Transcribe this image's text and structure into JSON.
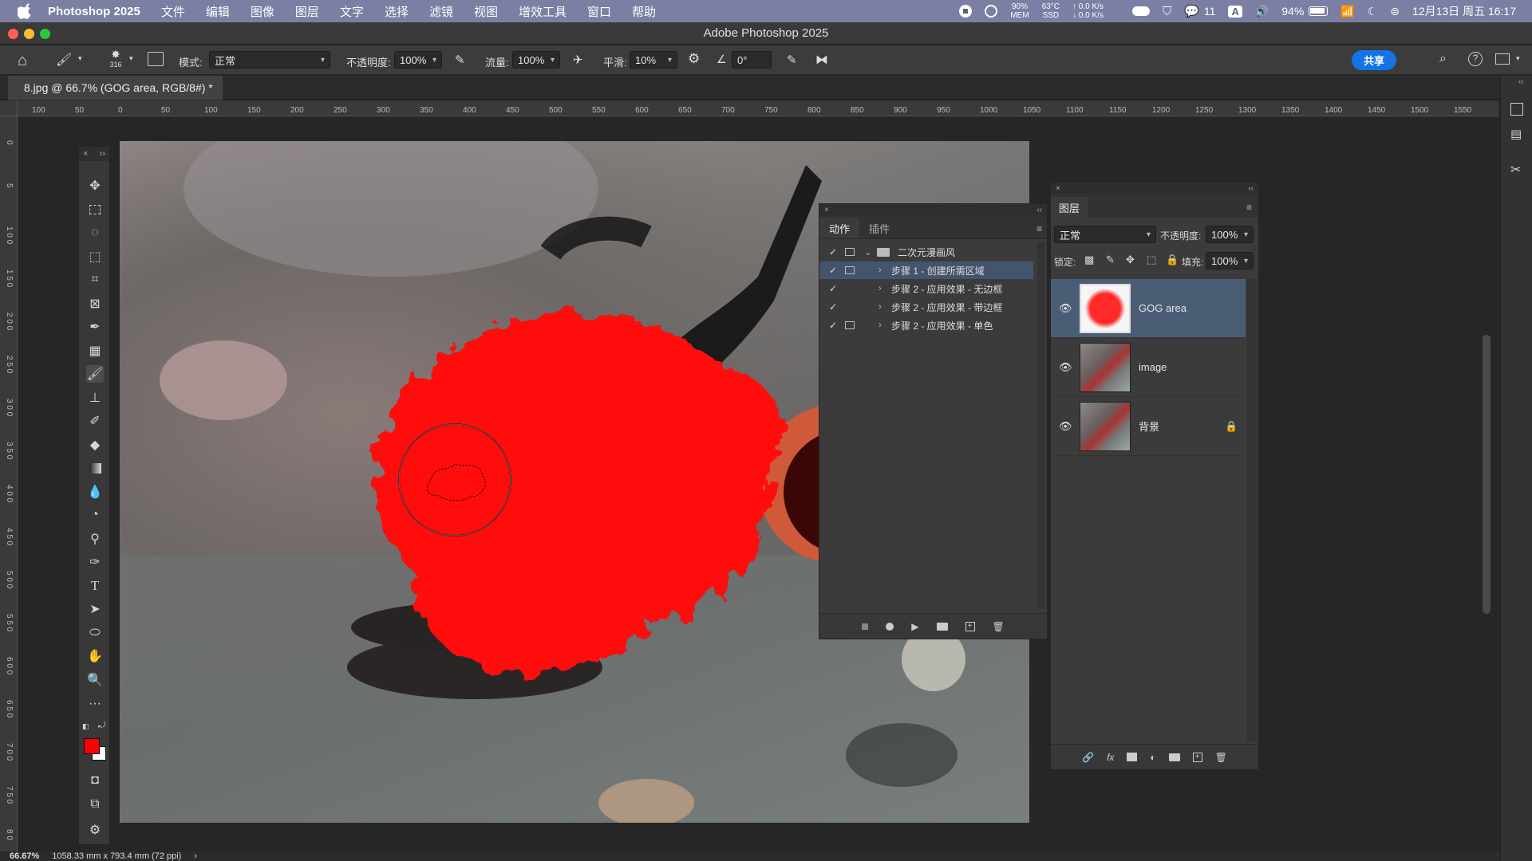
{
  "menubar": {
    "app": "Photoshop 2025",
    "items": [
      "文件",
      "编辑",
      "图像",
      "图层",
      "文字",
      "选择",
      "滤镜",
      "视图",
      "增效工具",
      "窗口",
      "帮助"
    ],
    "status": {
      "cpu": "90%",
      "cpu_label": "MEM",
      "temp": "63°C",
      "temp_label": "SSD",
      "net_up": "↑ 0.0 K/s",
      "net_down": "↓ 0.0 K/s",
      "wechat_count": "11",
      "input_method": "A",
      "battery": "94%",
      "datetime": "12月13日 周五  16:17"
    }
  },
  "titlebar": {
    "title": "Adobe Photoshop 2025"
  },
  "optionsbar": {
    "brush_size": "316",
    "mode_label": "模式:",
    "mode_value": "正常",
    "opacity_label": "不透明度:",
    "opacity_value": "100%",
    "flow_label": "流量:",
    "flow_value": "100%",
    "smooth_label": "平滑:",
    "smooth_value": "10%",
    "angle_value": "0°",
    "share_label": "共享"
  },
  "doctab": {
    "title": "8.jpg @ 66.7% (GOG area, RGB/8#) *",
    "close": "×"
  },
  "hruler": {
    "ticks": [
      "100",
      "50",
      "0",
      "50",
      "100",
      "150",
      "200",
      "250",
      "300",
      "350",
      "400",
      "450",
      "500",
      "550",
      "600",
      "650",
      "700",
      "750",
      "800",
      "850",
      "900",
      "950",
      "1000",
      "1050",
      "1100",
      "1150",
      "1200",
      "1250",
      "1300",
      "1350",
      "1400",
      "1450",
      "1500",
      "1550"
    ]
  },
  "vruler": {
    "ticks": [
      "0",
      "5",
      "1 0 0",
      "1 5 0",
      "2 0 0",
      "2 5 0",
      "3 0 0",
      "3 5 0",
      "4 0 0",
      "4 5 0",
      "5 0 0",
      "5 5 0",
      "6 0 0",
      "6 5 0",
      "7 0 0",
      "7 5 0",
      "8 0"
    ]
  },
  "toolbar": {
    "collapse": "×",
    "expand": "››"
  },
  "colors": {
    "foreground": "#ff0000",
    "background": "#ffffff",
    "accent": "#1473e6",
    "paint": "#ff0d0d"
  },
  "actions_panel": {
    "tabs": [
      "动作",
      "插件"
    ],
    "set_name": "二次元漫画风",
    "steps": [
      {
        "label": "步骤 1 - 创建所需区域",
        "selected": true
      },
      {
        "label": "步骤 2 - 应用效果 - 无边框",
        "selected": false
      },
      {
        "label": "步骤 2 - 应用效果 - 带边框",
        "selected": false
      },
      {
        "label": "步骤 2 - 应用效果 - 单色",
        "selected": false
      }
    ]
  },
  "layers_panel": {
    "tab": "图层",
    "blend_mode": "正常",
    "opacity_label": "不透明度:",
    "opacity_value": "100%",
    "lock_label": "锁定:",
    "fill_label": "填充:",
    "fill_value": "100%",
    "layers": [
      {
        "name": "GOG area",
        "selected": true,
        "locked": false
      },
      {
        "name": "image",
        "selected": false,
        "locked": false
      },
      {
        "name": "背景",
        "selected": false,
        "locked": true
      }
    ]
  },
  "statusbar": {
    "zoom": "66.67%",
    "doc_size": "1058.33 mm x 793.4 mm (72 ppi)",
    "arrow": "›"
  }
}
